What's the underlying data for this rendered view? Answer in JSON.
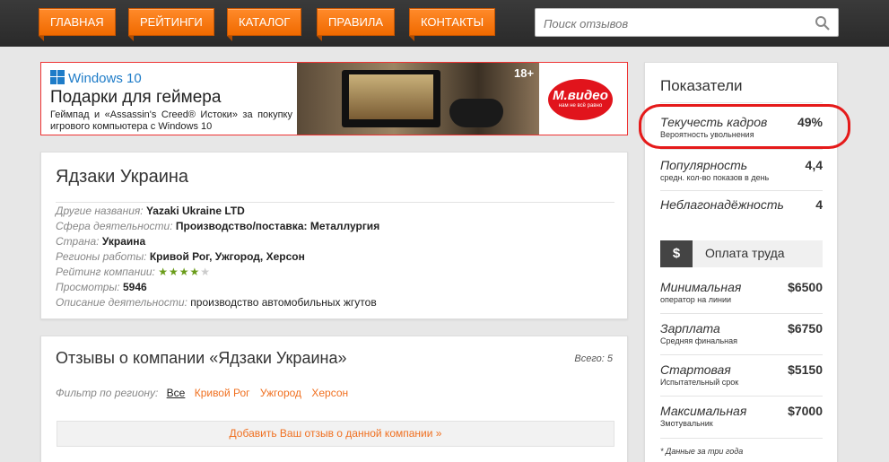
{
  "nav": {
    "items": [
      "ГЛАВНАЯ",
      "РЕЙТИНГИ",
      "КАТАЛОГ",
      "ПРАВИЛА",
      "КОНТАКТЫ"
    ],
    "search_placeholder": "Поиск отзывов"
  },
  "banner": {
    "brand": "Windows 10",
    "headline": "Подарки для геймера",
    "text": "Геймпад и «Assassin's Creed® Истоки» за покупку игрового компьютера с Windows 10",
    "age": "18+",
    "shop": "М.видео",
    "shop_slogan": "нам не всё равно"
  },
  "company": {
    "title": "Ядзаки Украина",
    "fields": [
      {
        "label": "Другие названия:",
        "value": "Yazaki Ukraine LTD"
      },
      {
        "label": "Сфера деятельности:",
        "value": "Производство/поставка: Металлургия"
      },
      {
        "label": "Страна:",
        "value": "Украина"
      },
      {
        "label": "Регионы работы:",
        "value": "Кривой Рог, Ужгород, Херсон"
      },
      {
        "label": "Рейтинг компании:",
        "value": ""
      },
      {
        "label": "Просмотры:",
        "value": "5946"
      },
      {
        "label": "Описание деятельности:",
        "value": "производство автомобильных жгутов"
      }
    ],
    "rating": 4,
    "rating_max": 5
  },
  "reviews": {
    "title": "Отзывы о компании «Ядзаки Украина»",
    "total": "Всего: 5",
    "filter_label": "Фильтр по региону:",
    "filter_current": "Все",
    "regions": [
      "Кривой Рог",
      "Ужгород",
      "Херсон"
    ],
    "add_link": "Добавить Ваш отзыв о данной компании »"
  },
  "sidebar": {
    "title": "Показатели",
    "metrics": [
      {
        "name": "Текучесть кадров",
        "sub": "Вероятность увольнения",
        "value": "49%"
      },
      {
        "name": "Популярность",
        "sub": "средн. кол-во показов в день",
        "value": "4,4"
      },
      {
        "name": "Неблагонадёжность",
        "sub": "",
        "value": "4"
      }
    ],
    "pay_icon": "$",
    "pay_title": "Оплата труда",
    "salaries": [
      {
        "name": "Минимальная",
        "sub": "оператор на линии",
        "value": "$6500"
      },
      {
        "name": "Зарплата",
        "sub": "Средняя финальная",
        "value": "$6750"
      },
      {
        "name": "Стартовая",
        "sub": "Испытательный срок",
        "value": "$5150"
      },
      {
        "name": "Максимальная",
        "sub": "Змотувальник",
        "value": "$7000"
      }
    ],
    "note": "* Данные за три года"
  },
  "colors": {
    "accent": "#f07020",
    "highlight": "#e51a1a",
    "rating": "#6a9c1a"
  }
}
